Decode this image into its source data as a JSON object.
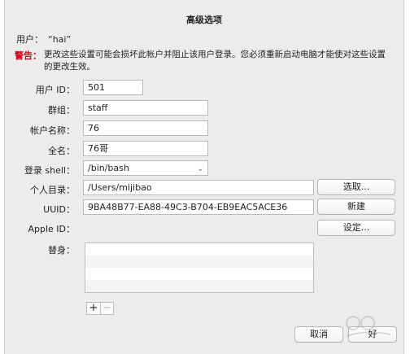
{
  "dialog": {
    "title": "高级选项"
  },
  "user": {
    "label": "用户：",
    "value": "“hai”"
  },
  "warning": {
    "label": "警告：",
    "text": "更改这些设置可能会损坏此帐户并阻止该用户登录。您必须重新启动电脑才能使对这些设置的更改生效。"
  },
  "form": {
    "user_id": {
      "label": "用户 ID：",
      "value": "501"
    },
    "group": {
      "label": "群组：",
      "value": "staff"
    },
    "account_name": {
      "label": "帐户名称：",
      "value": "76"
    },
    "full_name": {
      "label": "全名：",
      "value": "76哥"
    },
    "login_shell": {
      "label": "登录 shell：",
      "value": "/bin/bash"
    },
    "home_dir": {
      "label": "个人目录：",
      "value": "/Users/mijibao",
      "button": "选取..."
    },
    "uuid": {
      "label": "UUID：",
      "value": "9BA48B77-EA88-49C3-B704-EB9EAC5ACE36",
      "button": "新建"
    },
    "apple_id": {
      "label": "Apple ID：",
      "button": "设定..."
    },
    "aliases": {
      "label": "替身："
    }
  },
  "list_controls": {
    "add": "+",
    "remove": "−"
  },
  "footer": {
    "cancel": "取消",
    "ok": "好"
  }
}
